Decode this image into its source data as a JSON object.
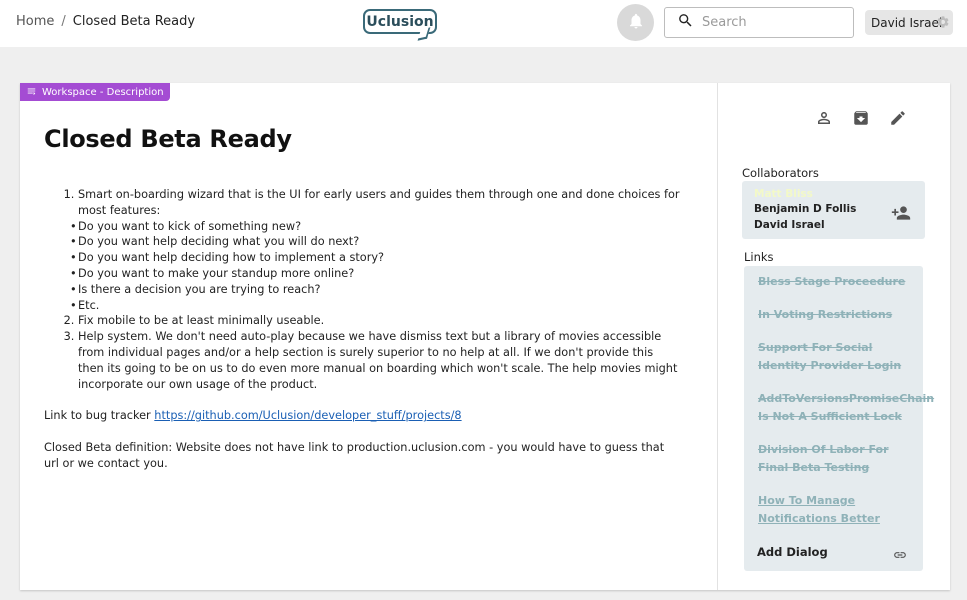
{
  "header": {
    "breadcrumb_home": "Home",
    "breadcrumb_sep": "/",
    "breadcrumb_current": "Closed Beta Ready",
    "logo_text": "Uclusion",
    "search_placeholder": "Search",
    "user_name": "David Israel"
  },
  "card": {
    "tag_label": "Workspace - Description",
    "title": "Closed Beta Ready",
    "ol_items_1": "Smart on-boarding wizard that is the UI for early users and guides them through one and done choices for most features:",
    "bullets": [
      "Do you want to kick of something new?",
      "Do you want help deciding what you will do next?",
      "Do you want help deciding how to implement a story?",
      "Do you want to make your standup more online?",
      "Is there a decision you are trying to reach?",
      "Etc."
    ],
    "ol_items_2": "Fix mobile to be at least minimally useable.",
    "ol_items_3": "Help system. We don't need auto-play because we have dismiss text but a library of movies accessible from individual pages and/or a help section is surely superior to no help at all. If we don't provide this then its going to be on us to do even more manual on boarding which won't scale. The help movies might incorporate our own usage of the product.",
    "bug_tracker_prefix": "Link to bug tracker ",
    "bug_tracker_url": "https://github.com/Uclusion/developer_stuff/projects/8",
    "beta_definition": "Closed Beta definition: Website does not have link to production.uclusion.com - you would have to guess that url or we contact you."
  },
  "sidebar": {
    "collaborators_label": "Collaborators",
    "collaborators": [
      "Matt Bliss",
      "Benjamin D Follis",
      "David Israel"
    ],
    "links_label": "Links",
    "links": [
      {
        "text": "Bless Stage Proceedure",
        "style": "strikethrough"
      },
      {
        "text": "In Voting Restrictions",
        "style": "strikethrough"
      },
      {
        "text": "Support For Social Identity Provider Login",
        "style": "strikethrough"
      },
      {
        "text": "AddToVersionsPromiseChain Is Not A Sufficient Lock",
        "style": "strikethrough"
      },
      {
        "text": "Division Of Labor For Final Beta Testing",
        "style": "strikethrough"
      },
      {
        "text": "How To Manage Notifications Better",
        "style": "underline"
      }
    ],
    "add_dialog_label": "Add Dialog"
  },
  "colors": {
    "tag_purple": "#a44cd3",
    "link_muted": "#8fb2b8",
    "panel_bg": "#e5ebee",
    "link_blue": "#1a5fb4"
  },
  "icons": [
    "search-icon",
    "bell-icon",
    "gear-icon",
    "person-icon",
    "archive-icon",
    "edit-icon",
    "add-person-icon",
    "link-icon",
    "notes-icon"
  ]
}
